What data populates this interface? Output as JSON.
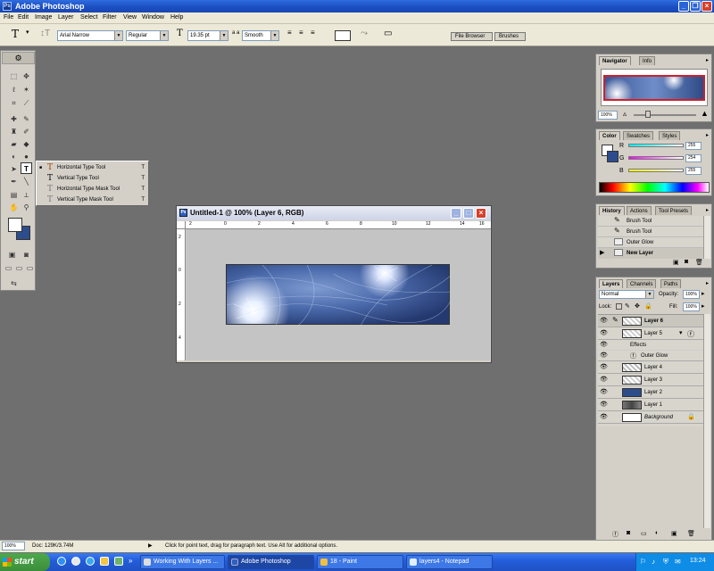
{
  "app": {
    "title": "Adobe Photoshop"
  },
  "menu": [
    "File",
    "Edit",
    "Image",
    "Layer",
    "Select",
    "Filter",
    "View",
    "Window",
    "Help"
  ],
  "options_bar": {
    "tool_glyph": "T",
    "font_family": "Arial Narrow",
    "font_style": "Regular",
    "font_size": "19.35 pt",
    "antialias_prefix": "a a",
    "antialias": "Smooth",
    "well_tabs": [
      "File Browser",
      "Brushes"
    ]
  },
  "flyout": {
    "items": [
      {
        "label": "Horizontal Type Tool",
        "shortcut": "T",
        "selected": true
      },
      {
        "label": "Vertical Type Tool",
        "shortcut": "T",
        "selected": false
      },
      {
        "label": "Horizontal Type Mask Tool",
        "shortcut": "T",
        "selected": false
      },
      {
        "label": "Vertical Type Mask Tool",
        "shortcut": "T",
        "selected": false
      }
    ]
  },
  "document": {
    "title": "Untitled-1 @ 100% (Layer 6, RGB)",
    "ruler_top": [
      "2",
      "0",
      "2",
      "4",
      "6",
      "8",
      "10",
      "12",
      "14",
      "16"
    ],
    "ruler_left": [
      "2",
      "0",
      "2",
      "4"
    ]
  },
  "navigator": {
    "tabs": [
      "Navigator",
      "Info"
    ],
    "zoom": "100%"
  },
  "color_panel": {
    "tabs": [
      "Color",
      "Swatches",
      "Styles"
    ],
    "channels": [
      {
        "name": "R",
        "value": "255"
      },
      {
        "name": "G",
        "value": "254"
      },
      {
        "name": "B",
        "value": "255"
      }
    ]
  },
  "history": {
    "tabs": [
      "History",
      "Actions",
      "Tool Presets"
    ],
    "items": [
      "Brush Tool",
      "Brush Tool",
      "Outer Glow",
      "New Layer"
    ]
  },
  "layers": {
    "tabs": [
      "Layers",
      "Channels",
      "Paths"
    ],
    "blend_mode": "Normal",
    "opacity_label": "Opacity:",
    "opacity": "100%",
    "fill_label": "Fill:",
    "fill": "100%",
    "lock_label": "Lock:",
    "rows": [
      {
        "name": "Layer 6",
        "selected": true
      },
      {
        "name": "Layer 5",
        "selected": false
      },
      {
        "name": "Effects",
        "selected": false
      },
      {
        "name": "Outer Glow",
        "selected": false
      },
      {
        "name": "Layer 4",
        "selected": false
      },
      {
        "name": "Layer 3",
        "selected": false
      },
      {
        "name": "Layer 2",
        "selected": false
      },
      {
        "name": "Layer 1",
        "selected": false
      },
      {
        "name": "Background",
        "selected": false
      }
    ]
  },
  "status_bar": {
    "zoom": "100%",
    "doc": "Doc: 129K/3.74M",
    "hint": "Click for point text, drag for paragraph text. Use Alt for additional options."
  },
  "taskbar": {
    "start": "start",
    "tasks": [
      {
        "label": "Working With Layers ...",
        "active": false
      },
      {
        "label": "Adobe Photoshop",
        "active": true
      },
      {
        "label": "18 - Paint",
        "active": false
      },
      {
        "label": "layers4 - Notepad",
        "active": false
      }
    ],
    "clock": "13:24"
  },
  "colors": {
    "xp_blue": "#245edb",
    "foreground_swatch": "#ffffff",
    "background_swatch": "#2d4c8c",
    "selection": "#ffffff"
  }
}
